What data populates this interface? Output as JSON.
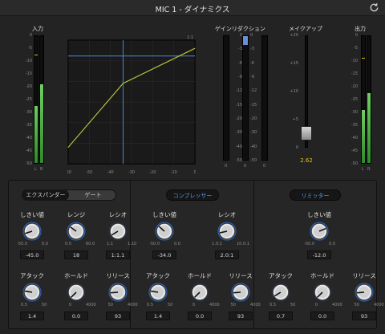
{
  "window": {
    "title": "MIC 1 - ダイナミクス",
    "reset_icon": "reset-icon"
  },
  "sections": {
    "input": "入力",
    "gain_reduction": "ゲインリダクション",
    "makeup": "メイクアップ",
    "output": "出力"
  },
  "input_meter": {
    "scale": [
      "0",
      "-5",
      "-10",
      "-15",
      "-20",
      "-25",
      "-30",
      "-35",
      "-40",
      "-45",
      "-50"
    ],
    "channels": [
      "L",
      "R"
    ],
    "levels": [
      0.45,
      0.62
    ],
    "peak": 0.85
  },
  "graph": {
    "x_ticks": [
      "-60",
      "-50",
      "-40",
      "-30",
      "-20",
      "-10",
      "0"
    ],
    "top_right": "1:1",
    "threshold_db": -34,
    "curve_color": "#b8c040",
    "line_color": "#4a86d6"
  },
  "gain_reduction_meter": {
    "scale": [
      "0",
      "-3",
      "-6",
      "-9",
      "-12",
      "-15",
      "-20",
      "-30",
      "-40",
      "-50"
    ],
    "channels": [
      "E",
      "C",
      "L"
    ],
    "reduction": [
      0,
      0.07,
      0
    ],
    "bottom": [
      "0",
      "0",
      "0"
    ]
  },
  "makeup": {
    "scale": [
      "+20",
      "+15",
      "+10",
      "+5",
      "0"
    ],
    "value": "2.62",
    "level": 0.87
  },
  "output_meter": {
    "scale": [
      "0",
      "-5",
      "-10",
      "-15",
      "-20",
      "-25",
      "-30",
      "-35",
      "-40",
      "-45",
      "-50"
    ],
    "channels": [
      "L",
      "R"
    ],
    "levels": [
      0.42,
      0.55
    ],
    "peak": 0.82
  },
  "expander": {
    "tab_expander": "エクスパンダー",
    "tab_gate": "ゲート",
    "threshold": {
      "label": "しきい値",
      "value": "-45.0",
      "min": "-50.0",
      "max": "0.0",
      "level": 0.1
    },
    "range": {
      "label": "レンジ",
      "value": "18",
      "min": "0.0",
      "max": "60.0",
      "level": 0.3
    },
    "ratio": {
      "label": "レシオ",
      "value": "1:1.1",
      "min": "1:1",
      "max": "1:10",
      "level": 0.05
    },
    "attack": {
      "label": "アタック",
      "value": "1.4",
      "min": "0.5",
      "max": "50",
      "level": 0.2
    },
    "hold": {
      "label": "ホールド",
      "value": "0.0",
      "min": "0",
      "max": "4000",
      "level": 0.0
    },
    "release": {
      "label": "リリース",
      "value": "93",
      "min": "50",
      "max": "4000",
      "level": 0.15
    }
  },
  "compressor": {
    "tab": "コンプレッサー",
    "threshold": {
      "label": "しきい値",
      "value": "-34.0",
      "min": "-50.0",
      "max": "0.0",
      "level": 0.32
    },
    "ratio": {
      "label": "レシオ",
      "value": "2.0:1",
      "min": "1.0:1",
      "max": "10.0:1",
      "level": 0.12
    },
    "attack": {
      "label": "アタック",
      "value": "1.4",
      "min": "0.5",
      "max": "50",
      "level": 0.2
    },
    "hold": {
      "label": "ホールド",
      "value": "0.0",
      "min": "0",
      "max": "4000",
      "level": 0.0
    },
    "release": {
      "label": "リリース",
      "value": "93",
      "min": "50",
      "max": "4000",
      "level": 0.15
    }
  },
  "limiter": {
    "tab": "リミッター",
    "threshold": {
      "label": "しきい値",
      "value": "-12.0",
      "min": "-50.0",
      "max": "0.0",
      "level": 0.75
    },
    "attack": {
      "label": "アタック",
      "value": "0.7",
      "min": "0.5",
      "max": "50",
      "level": 0.05
    },
    "hold": {
      "label": "ホールド",
      "value": "0.0",
      "min": "0",
      "max": "4000",
      "level": 0.0
    },
    "release": {
      "label": "リリース",
      "value": "93",
      "min": "50",
      "max": "4000",
      "level": 0.15
    }
  }
}
